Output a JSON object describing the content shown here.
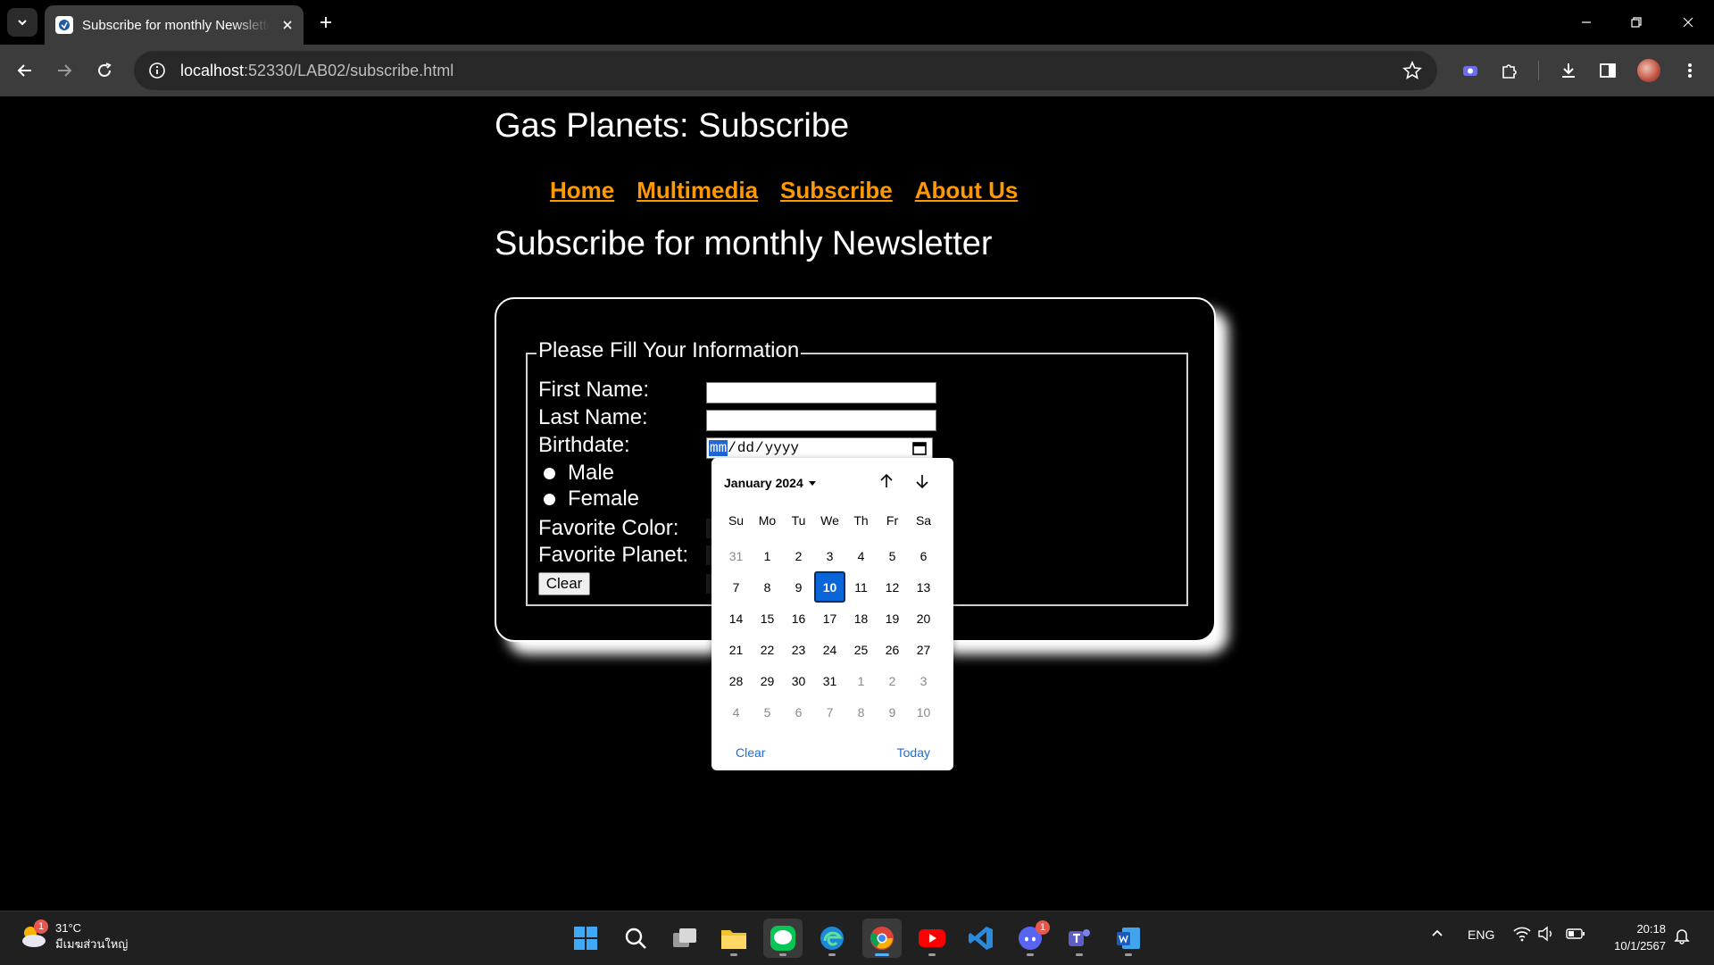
{
  "browser": {
    "tab_title": "Subscribe for monthly Newsletter",
    "url_host": "localhost",
    "url_rest": ":52330/LAB02/subscribe.html"
  },
  "page": {
    "site_title": "Gas Planets: Subscribe",
    "nav": [
      "Home",
      "Multimedia",
      "Subscribe",
      "About Us"
    ],
    "heading": "Subscribe for monthly Newsletter",
    "form": {
      "legend": "Please Fill Your Information",
      "first_name_label": "First Name:",
      "last_name_label": "Last Name:",
      "birthdate_label": "Birthdate:",
      "birthdate_month": "mm",
      "birthdate_day": "dd",
      "birthdate_year": "yyyy",
      "gender_options": [
        "Male",
        "Female"
      ],
      "favorite_color_label": "Favorite Color:",
      "favorite_planet_label": "Favorite Planet:",
      "clear_button": "Clear"
    }
  },
  "date_picker": {
    "month_label": "January 2024",
    "weekdays": [
      "Su",
      "Mo",
      "Tu",
      "We",
      "Th",
      "Fr",
      "Sa"
    ],
    "weeks": [
      [
        {
          "d": "31",
          "m": true
        },
        {
          "d": "1"
        },
        {
          "d": "2"
        },
        {
          "d": "3"
        },
        {
          "d": "4"
        },
        {
          "d": "5"
        },
        {
          "d": "6"
        }
      ],
      [
        {
          "d": "7"
        },
        {
          "d": "8"
        },
        {
          "d": "9"
        },
        {
          "d": "10",
          "sel": true
        },
        {
          "d": "11"
        },
        {
          "d": "12"
        },
        {
          "d": "13"
        }
      ],
      [
        {
          "d": "14"
        },
        {
          "d": "15"
        },
        {
          "d": "16"
        },
        {
          "d": "17"
        },
        {
          "d": "18"
        },
        {
          "d": "19"
        },
        {
          "d": "20"
        }
      ],
      [
        {
          "d": "21"
        },
        {
          "d": "22"
        },
        {
          "d": "23"
        },
        {
          "d": "24"
        },
        {
          "d": "25"
        },
        {
          "d": "26"
        },
        {
          "d": "27"
        }
      ],
      [
        {
          "d": "28"
        },
        {
          "d": "29"
        },
        {
          "d": "30"
        },
        {
          "d": "31"
        },
        {
          "d": "1",
          "m": true
        },
        {
          "d": "2",
          "m": true
        },
        {
          "d": "3",
          "m": true
        }
      ],
      [
        {
          "d": "4",
          "m": true
        },
        {
          "d": "5",
          "m": true
        },
        {
          "d": "6",
          "m": true
        },
        {
          "d": "7",
          "m": true
        },
        {
          "d": "8",
          "m": true
        },
        {
          "d": "9",
          "m": true
        },
        {
          "d": "10",
          "m": true
        }
      ]
    ],
    "clear_label": "Clear",
    "today_label": "Today"
  },
  "taskbar": {
    "weather_temp": "31°C",
    "weather_desc": "มีเมฆส่วนใหญ่",
    "weather_badge": "1",
    "discord_badge": "1",
    "language": "ENG",
    "time": "20:18",
    "date": "10/1/2567"
  },
  "colors": {
    "nav_link": "#ff9900",
    "selected_day": "#0a66d8",
    "picker_action": "#1a6ed8"
  }
}
